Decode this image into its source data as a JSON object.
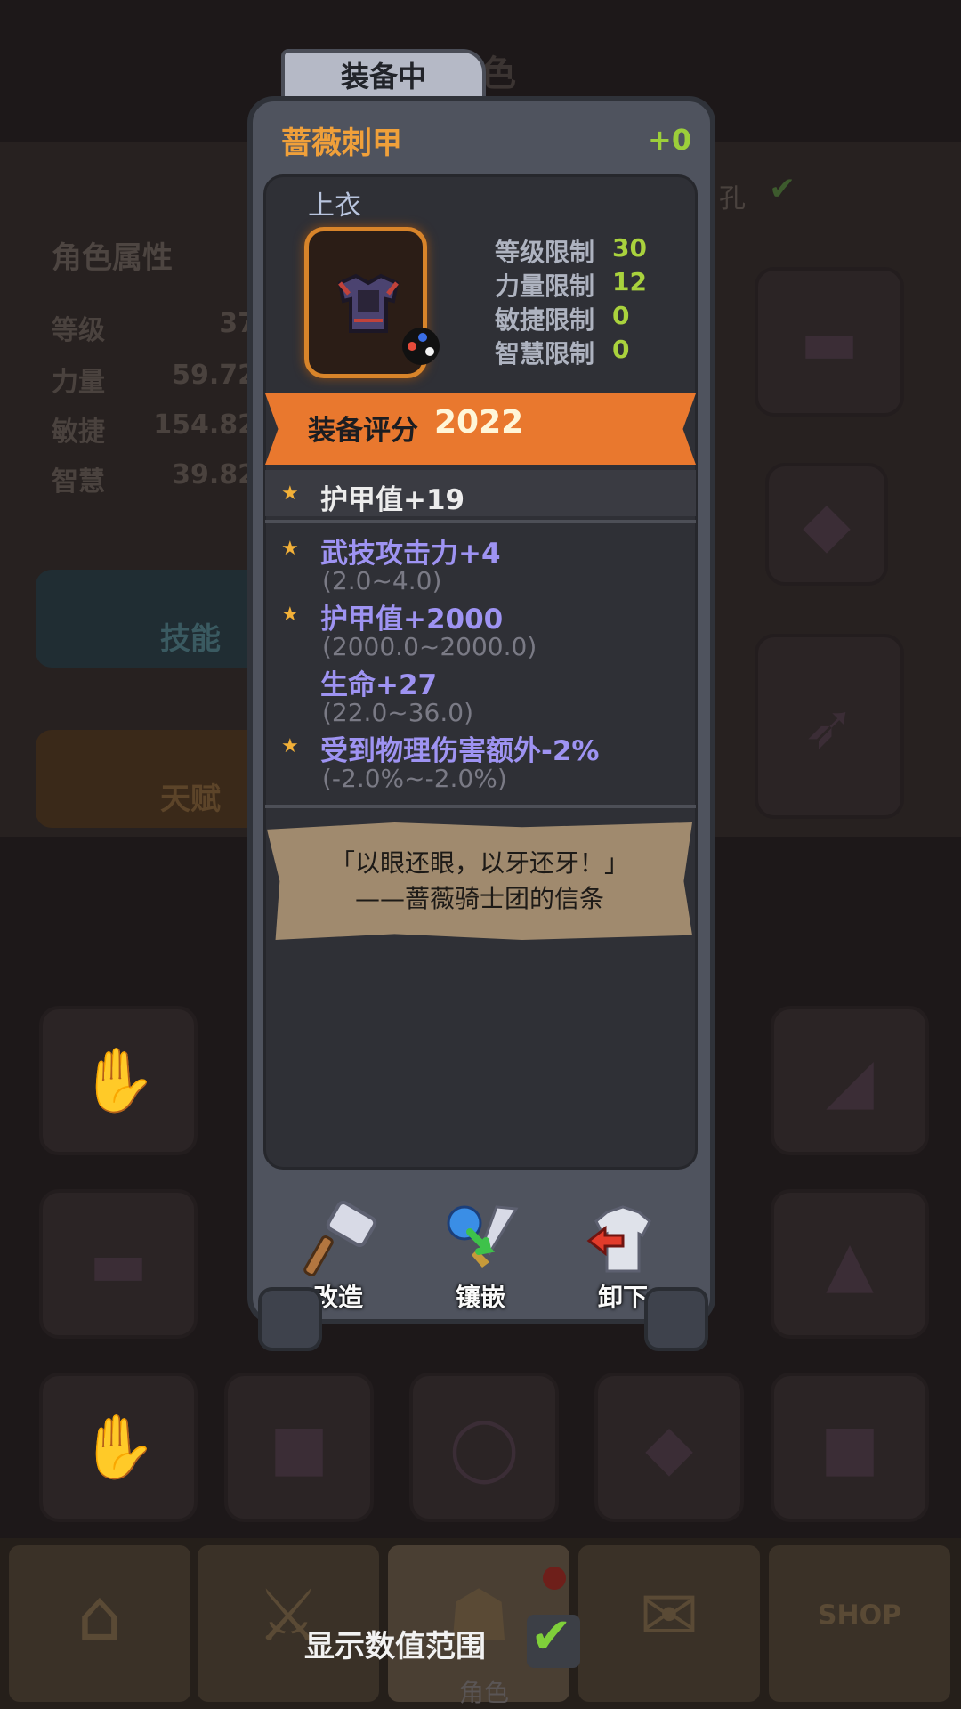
{
  "background": {
    "screen_title_partial": "色",
    "stats_title": "角色属性",
    "stats": [
      {
        "label": "等级",
        "value": "37"
      },
      {
        "label": "力量",
        "value": "59.72"
      },
      {
        "label": "敏捷",
        "value": "154.82"
      },
      {
        "label": "智慧",
        "value": "39.82"
      }
    ],
    "skill_label": "技能",
    "talent_label": "天赋",
    "hole_label_partial": "孔"
  },
  "popup": {
    "tab_label": "装备中",
    "item_name": "蔷薇刺甲",
    "enhance_level": "+0",
    "slot_type": "上衣",
    "requirements": [
      {
        "label": "等级限制",
        "value": "30"
      },
      {
        "label": "力量限制",
        "value": "12"
      },
      {
        "label": "敏捷限制",
        "value": "0"
      },
      {
        "label": "智慧限制",
        "value": "0"
      }
    ],
    "score_label": "装备评分",
    "score_value": "2022",
    "base_attribute": "护甲值+19",
    "attributes": [
      {
        "text": "武技攻击力+4",
        "range": "(2.0~4.0)",
        "starred": true
      },
      {
        "text": "护甲值+2000",
        "range": "(2000.0~2000.0)",
        "starred": true
      },
      {
        "text": "生命+27",
        "range": "(22.0~36.0)",
        "starred": false
      },
      {
        "text": "受到物理伤害额外-2%",
        "range": "(-2.0%~-2.0%)",
        "starred": true
      }
    ],
    "quote_line1": "「以眼还眼，以牙还牙！」",
    "quote_line2": "——蔷薇骑士团的信条",
    "actions": [
      {
        "label": "改造",
        "icon": "hammer-icon"
      },
      {
        "label": "镶嵌",
        "icon": "gem-sword-icon"
      },
      {
        "label": "卸下",
        "icon": "unequip-armor-icon"
      }
    ]
  },
  "toggle": {
    "label": "显示数值范围",
    "checked": true
  },
  "nav": {
    "active_label": "角色",
    "items": [
      "home-icon",
      "battle-icon",
      "character-icon",
      "quest-scroll-icon",
      "shop-icon"
    ],
    "shop_text": "SHOP"
  },
  "colors": {
    "item_name": "#f0a03a",
    "enhance": "#9ccf3a",
    "requirement_value": "#a9d23d",
    "score_ribbon": "#e9782e",
    "magic_attribute": "#9e93f2",
    "range_text": "#7a7a85",
    "quote_paper": "#a08a6e"
  }
}
